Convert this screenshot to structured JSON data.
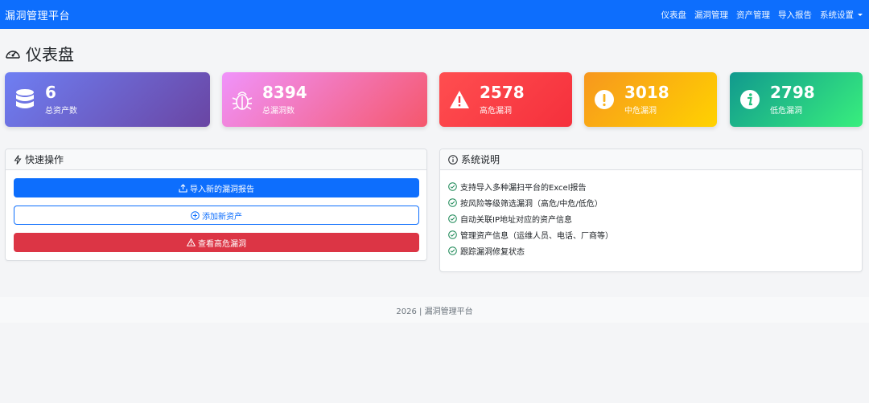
{
  "navbar": {
    "brand": "漏洞管理平台",
    "items": [
      {
        "label": "仪表盘"
      },
      {
        "label": "漏洞管理"
      },
      {
        "label": "资产管理"
      },
      {
        "label": "导入报告"
      },
      {
        "label": "系统设置"
      }
    ]
  },
  "page": {
    "title": "仪表盘",
    "icon": "speedometer-icon"
  },
  "stats": [
    {
      "value": "6",
      "label": "总资产数",
      "icon": "database-icon"
    },
    {
      "value": "8394",
      "label": "总漏洞数",
      "icon": "bug-icon"
    },
    {
      "value": "2578",
      "label": "高危漏洞",
      "icon": "warning-triangle-icon"
    },
    {
      "value": "3018",
      "label": "中危漏洞",
      "icon": "exclamation-circle-icon"
    },
    {
      "value": "2798",
      "label": "低危漏洞",
      "icon": "info-circle-icon"
    }
  ],
  "quick_actions": {
    "title": "快速操作",
    "buttons": [
      {
        "label": "导入新的漏洞报告",
        "icon": "upload-icon"
      },
      {
        "label": "添加新资产",
        "icon": "plus-circle-icon"
      },
      {
        "label": "查看高危漏洞",
        "icon": "warning-icon"
      }
    ]
  },
  "system_info": {
    "title": "系统说明",
    "items": [
      "支持导入多种漏扫平台的Excel报告",
      "按风险等级筛选漏洞（高危/中危/低危）",
      "自动关联IP地址对应的资产信息",
      "管理资产信息（运维人员、电话、厂商等）",
      "跟踪漏洞修复状态"
    ]
  },
  "footer": {
    "text": "2026 | 漏洞管理平台"
  },
  "colors": {
    "primary": "#0d6efd",
    "danger": "#dc3545"
  }
}
